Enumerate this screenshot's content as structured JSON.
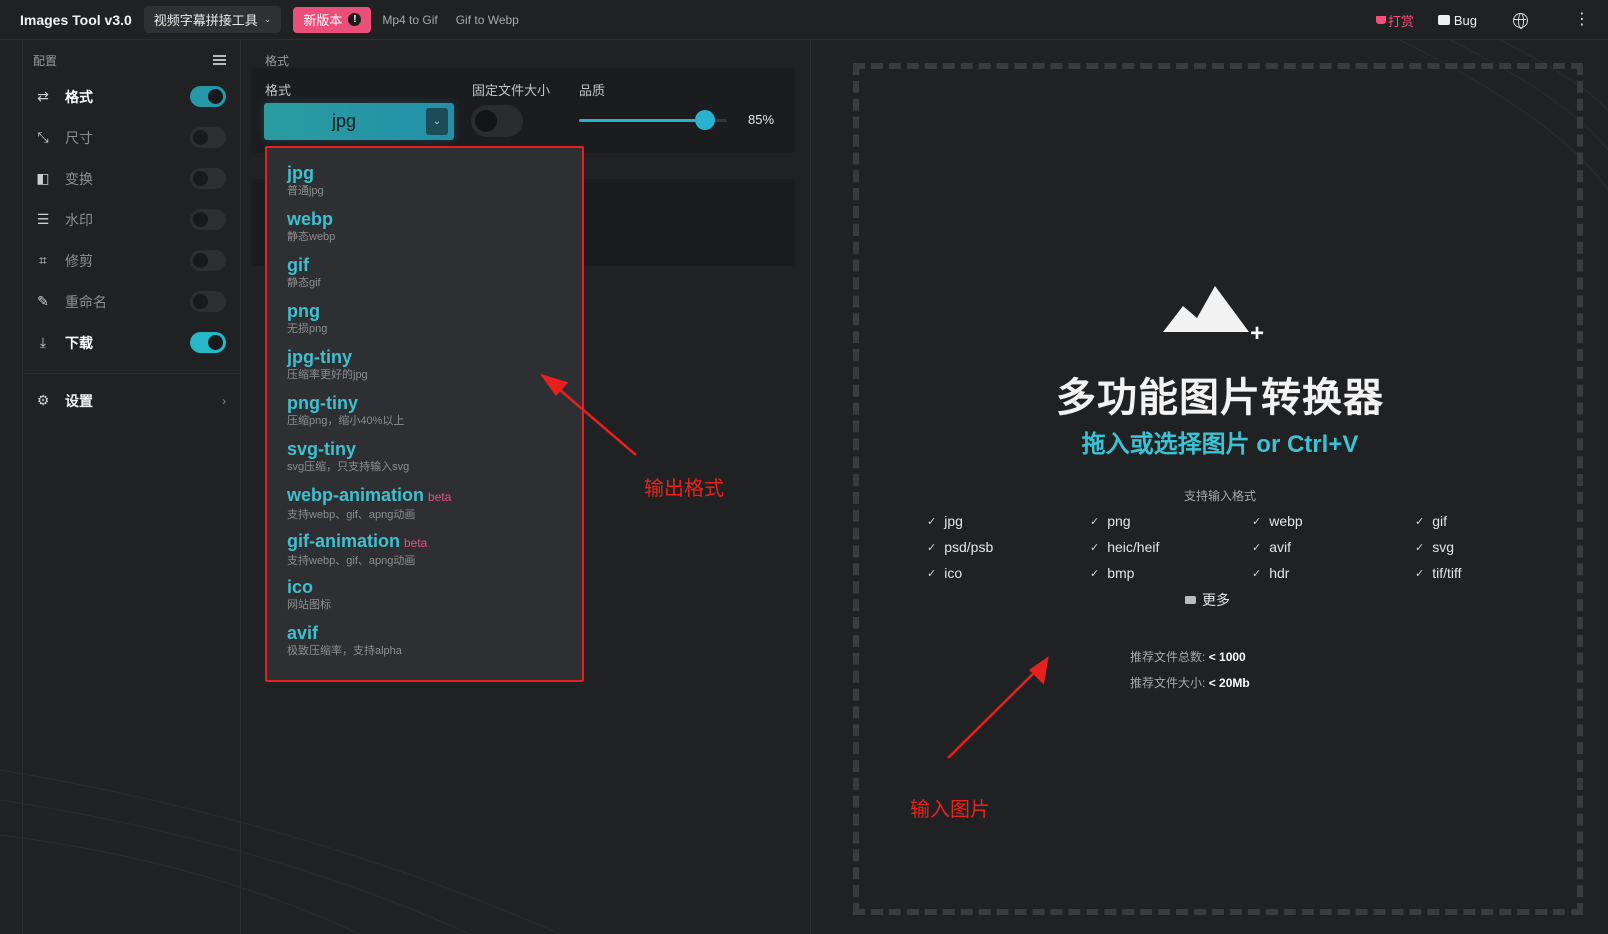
{
  "topbar": {
    "brand": "Images Tool v3.0",
    "tool_select": "视频字幕拼接工具",
    "new_badge": "新版本",
    "links": [
      "Mp4 to Gif",
      "Gif to Webp"
    ],
    "donate": "打赏",
    "bug": "Bug"
  },
  "sidebar": {
    "header": "配置",
    "items": [
      {
        "label": "格式",
        "icon": "swap-icon",
        "enabled": true
      },
      {
        "label": "尺寸",
        "icon": "resize-icon",
        "enabled": false
      },
      {
        "label": "变换",
        "icon": "transform-icon",
        "enabled": false
      },
      {
        "label": "水印",
        "icon": "watermark-icon",
        "enabled": false
      },
      {
        "label": "修剪",
        "icon": "crop-icon",
        "enabled": false
      },
      {
        "label": "重命名",
        "icon": "rename-icon",
        "enabled": false
      },
      {
        "label": "下载",
        "icon": "download-icon",
        "enabled": true
      }
    ],
    "settings": "设置"
  },
  "format_panel": {
    "section_label": "格式",
    "format_label": "格式",
    "fixed_size_label": "固定文件大小",
    "quality_label": "品质",
    "selected_format": "jpg",
    "fixed_size_enabled": false,
    "quality_percent": 85,
    "quality_text": "85%"
  },
  "dropdown": {
    "options": [
      {
        "name": "jpg",
        "desc": "普通jpg",
        "beta": ""
      },
      {
        "name": "webp",
        "desc": "静态webp",
        "beta": ""
      },
      {
        "name": "gif",
        "desc": "静态gif",
        "beta": ""
      },
      {
        "name": "png",
        "desc": "无损png",
        "beta": ""
      },
      {
        "name": "jpg-tiny",
        "desc": "压缩率更好的jpg",
        "beta": ""
      },
      {
        "name": "png-tiny",
        "desc": "压缩png，缩小40%以上",
        "beta": ""
      },
      {
        "name": "svg-tiny",
        "desc": "svg压缩，只支持输入svg",
        "beta": ""
      },
      {
        "name": "webp-animation",
        "desc": "支持webp、gif、apng动画",
        "beta": "beta"
      },
      {
        "name": "gif-animation",
        "desc": "支持webp、gif、apng动画",
        "beta": "beta"
      },
      {
        "name": "ico",
        "desc": "网站图标",
        "beta": ""
      },
      {
        "name": "avif",
        "desc": "极致压缩率，支持alpha",
        "beta": ""
      }
    ]
  },
  "annotations": {
    "output_format": "输出格式",
    "input_image": "输入图片"
  },
  "dropzone": {
    "title": "多功能图片转换器",
    "subtitle": "拖入或选择图片 or Ctrl+V",
    "formats_title": "支持输入格式",
    "formats": [
      "jpg",
      "png",
      "webp",
      "gif",
      "psd/psb",
      "heic/heif",
      "avif",
      "svg",
      "ico",
      "bmp",
      "hdr",
      "tif/tiff"
    ],
    "more": "更多",
    "rec_count_label": "推荐文件总数:",
    "rec_count_value": "< 1000",
    "rec_size_label": "推荐文件大小:",
    "rec_size_value": "< 20Mb"
  },
  "colors": {
    "accent": "#28b2cf",
    "pink": "#ea4f7a",
    "annotation_red": "#e5201f"
  }
}
